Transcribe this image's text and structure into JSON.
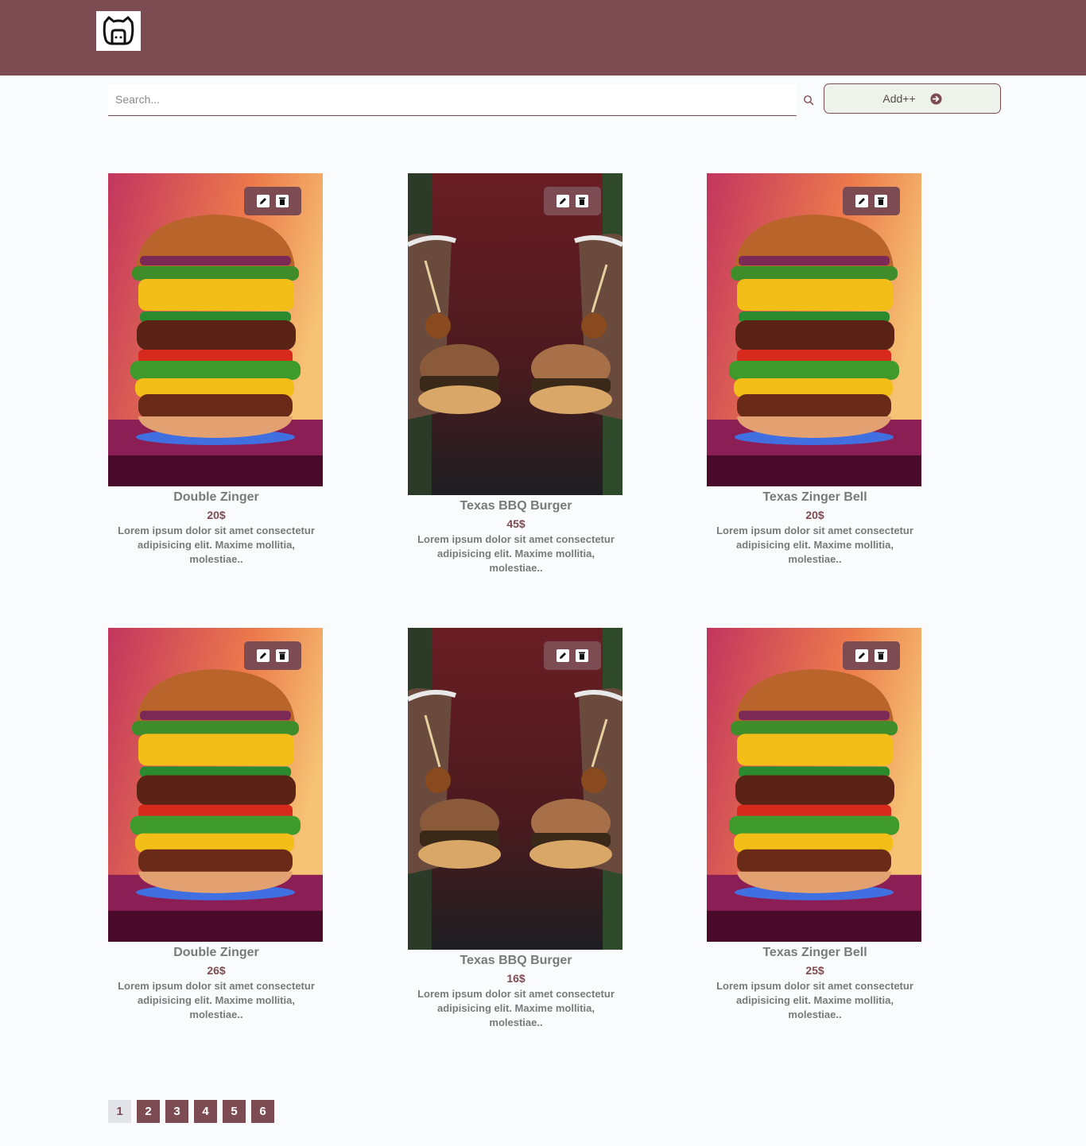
{
  "search": {
    "placeholder": "Search..."
  },
  "add_button": {
    "label": "Add++"
  },
  "products": [
    {
      "name": "Double Zinger",
      "price": "20$",
      "description": "Lorem ipsum dolor sit amet consectetur adipisicing elit. Maxime mollitia, molestiae..",
      "image": "stacked-burger"
    },
    {
      "name": "Texas BBQ Burger",
      "price": "45$",
      "description": "Lorem ipsum dolor sit amet consectetur adipisicing elit. Maxime mollitia, molestiae..",
      "image": "two-burgers-held"
    },
    {
      "name": "Texas Zinger Bell",
      "price": "20$",
      "description": "Lorem ipsum dolor sit amet consectetur adipisicing elit. Maxime mollitia, molestiae..",
      "image": "stacked-burger"
    },
    {
      "name": "Double Zinger",
      "price": "26$",
      "description": "Lorem ipsum dolor sit amet consectetur adipisicing elit. Maxime mollitia, molestiae..",
      "image": "stacked-burger"
    },
    {
      "name": "Texas BBQ Burger",
      "price": "16$",
      "description": "Lorem ipsum dolor sit amet consectetur adipisicing elit. Maxime mollitia, molestiae..",
      "image": "two-burgers-held"
    },
    {
      "name": "Texas Zinger Bell",
      "price": "25$",
      "description": "Lorem ipsum dolor sit amet consectetur adipisicing elit. Maxime mollitia, molestiae..",
      "image": "stacked-burger"
    }
  ],
  "pagination": {
    "pages": [
      "1",
      "2",
      "3",
      "4",
      "5",
      "6"
    ],
    "current": "1"
  },
  "colors": {
    "brand": "#7d4c52",
    "background": "#f9fbfd",
    "add_button_bg": "#edf3eb",
    "text_muted": "#7a7a7a"
  },
  "icons": {
    "logo": "cat-face-icon",
    "search": "search-icon",
    "add": "arrow-circle-right-icon",
    "edit": "pencil-icon",
    "delete": "trash-icon"
  }
}
